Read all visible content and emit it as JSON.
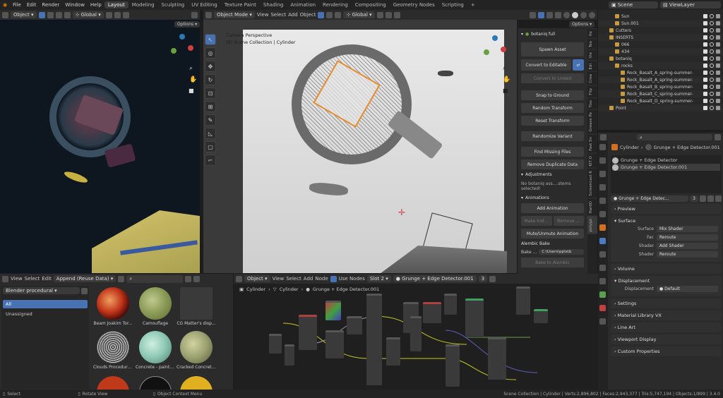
{
  "topmenu": {
    "items": [
      "File",
      "Edit",
      "Render",
      "Window",
      "Help"
    ],
    "workspaces": [
      "Layout",
      "Modeling",
      "Sculpting",
      "UV Editing",
      "Texture Paint",
      "Shading",
      "Animation",
      "Rendering",
      "Compositing",
      "Geometry Nodes",
      "Scripting"
    ],
    "active_workspace": "Layout",
    "scene": "Scene",
    "view_layer": "ViewLayer"
  },
  "left_viewport": {
    "mode": "Object",
    "transform": "Global",
    "options": "Options"
  },
  "main_viewport": {
    "mode": "Object Mode",
    "menus": [
      "View",
      "Select",
      "Add",
      "Object"
    ],
    "transform": "Global",
    "options": "Options",
    "camera_text": "Camera Perspective",
    "collection_text": "(8) Scene Collection | Cylinder"
  },
  "npanel": {
    "title": "botaniq full",
    "buttons": {
      "spawn": "Spawn Asset",
      "convert_editable": "Convert to Editable",
      "convert_linked": "Convert to Linked",
      "snap": "Snap to Ground",
      "random_transform": "Random Transform",
      "reset_transform": "Reset Transform",
      "randomize_variant": "Randomize Variant",
      "find_missing": "Find Missing Files",
      "remove_duplicate": "Remove Duplicate Data",
      "add_animation": "Add Animation",
      "make_inst": "Make Inst...",
      "remove": "Remove ...",
      "mute_unmute": "Mute/Unmute Animation",
      "bake_alembic": "Bake to Alembic"
    },
    "sections": {
      "adjustments": "Adjustments",
      "animations": "Animations",
      "alembic_bake": "Alembic Bake"
    },
    "no_assets": "No botaniq ass....stems selected!",
    "bake_label": "Bake ...",
    "bake_path": "C:\\Users\\ppla\\b"
  },
  "vertical_tabs": [
    "Ite",
    "Too",
    "Vie",
    "Edi",
    "Crea",
    "Flip",
    "Tiss",
    "Grease Pe",
    "Fast Sn",
    "KIT O",
    "Screencast K",
    "HardO",
    "polygo"
  ],
  "outliner": {
    "rows": [
      {
        "name": "Sun",
        "indent": 3
      },
      {
        "name": "Sun.001",
        "indent": 3
      },
      {
        "name": "Cutters",
        "indent": 2
      },
      {
        "name": "INSERTS",
        "indent": 2
      },
      {
        "name": "066",
        "indent": 3
      },
      {
        "name": "434",
        "indent": 3
      },
      {
        "name": "botaniq",
        "indent": 2
      },
      {
        "name": "rocks",
        "indent": 3
      },
      {
        "name": "Rock_Basalt_A_spring-summer-",
        "indent": 4
      },
      {
        "name": "Rock_Basalt_A_spring-summer-",
        "indent": 4
      },
      {
        "name": "Rock_Basalt_B_spring-summer-",
        "indent": 4
      },
      {
        "name": "Rock_Basalt_C_spring-summer-",
        "indent": 4
      },
      {
        "name": "Rock_Basalt_D_spring-summer-",
        "indent": 4
      },
      {
        "name": "Point",
        "indent": 2
      }
    ]
  },
  "properties": {
    "breadcrumb_object": "Cylinder",
    "breadcrumb_material": "Grunge + Edge Detector.001",
    "slots": [
      "Grunge + Edge Detector",
      "Grunge + Edge Detector.001"
    ],
    "material_name": "Grunge + Edge Detec...",
    "users": "3",
    "panels": {
      "preview": "Preview",
      "surface": "Surface",
      "volume": "Volume",
      "displacement": "Displacement",
      "settings": "Settings",
      "material_library": "Material Library VX",
      "line_art": "Line Art",
      "viewport_display": "Viewport Display",
      "custom_properties": "Custom Properties"
    },
    "surface_rows": [
      {
        "label": "Surface",
        "value": "Mix Shader"
      },
      {
        "label": "Fac",
        "value": "Reroute"
      },
      {
        "label": "Shader",
        "value": "Add Shader"
      },
      {
        "label": "Shader",
        "value": "Reroute"
      }
    ],
    "displacement_row": {
      "label": "Displacement",
      "value": "Default"
    }
  },
  "asset_browser": {
    "menus": [
      "View",
      "Select",
      "Edit"
    ],
    "import_mode": "Append (Reuse Data)",
    "library": "Blender procedural",
    "categories": [
      "All",
      "Unassigned"
    ],
    "assets": [
      {
        "name": "Beam Joakim Tor...",
        "color": "#c0341a"
      },
      {
        "name": "Camouflage",
        "color": "#8a9a55"
      },
      {
        "name": "CG Matter's disp...",
        "color": "#3a3a3a"
      },
      {
        "name": "Clouds Procedural...",
        "color": "#9a9a9a"
      },
      {
        "name": "Concrete - painte...",
        "color": "#8cc7b4"
      },
      {
        "name": "Cracked Concrete...",
        "color": "#9aa070"
      }
    ]
  },
  "node_editor": {
    "mode": "Object",
    "menus": [
      "View",
      "Select",
      "Add",
      "Node"
    ],
    "use_nodes": "Use Nodes",
    "slot": "Slot 2",
    "material": "Grunge + Edge Detector.001",
    "users": "3",
    "breadcrumb": [
      "Cylinder",
      "Cylinder",
      "Grunge + Edge Detector.001"
    ]
  },
  "statusbar": {
    "left": [
      "Select",
      "Rotate View",
      "Object Context Menu"
    ],
    "right": "Scene Collection | Cylinder | Verts:2,896,802 | Faces:2,943,377 | Tris:5,747,194 | Objects:1/899 | 3.4.0"
  }
}
